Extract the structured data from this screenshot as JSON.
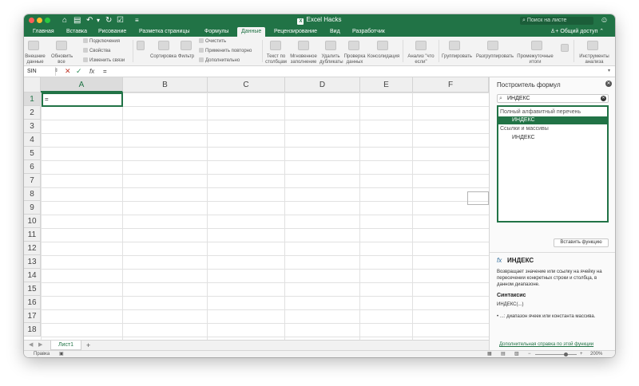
{
  "titlebar": {
    "doc_title": "Excel Hacks",
    "search_placeholder": "Поиск на листе",
    "share": "Общий доступ"
  },
  "tabs": [
    {
      "label": "Главная"
    },
    {
      "label": "Вставка"
    },
    {
      "label": "Рисование"
    },
    {
      "label": "Разметка страницы"
    },
    {
      "label": "Формулы"
    },
    {
      "label": "Данные",
      "active": true
    },
    {
      "label": "Рецензирование"
    },
    {
      "label": "Вид"
    },
    {
      "label": "Разработчик"
    }
  ],
  "ribbon": {
    "get_data": "Внешние данные",
    "refresh_all": "Обновить все",
    "connections": "Подключения",
    "properties": "Свойства",
    "edit_links": "Изменить связи",
    "sort": "Сортировка",
    "filter": "Фильтр",
    "clear": "Очистить",
    "reapply": "Применить повторно",
    "advanced": "Дополнительно",
    "text_to_columns": "Текст по столбцам",
    "flash_fill": "Мгновенное заполнение",
    "remove_duplicates": "Удалить дубликаты",
    "data_validation": "Проверка данных",
    "consolidate": "Консолидация",
    "what_if": "Анализ \"что если\"",
    "group": "Группировать",
    "ungroup": "Разгруппировать",
    "subtotal": "Промежуточные итоги",
    "analysis_tools": "Инструменты анализа"
  },
  "formula_bar": {
    "name_box": "SIN",
    "value": "="
  },
  "grid": {
    "columns": [
      "A",
      "B",
      "C",
      "D",
      "E",
      "F"
    ],
    "rows": [
      "1",
      "2",
      "3",
      "4",
      "5",
      "6",
      "7",
      "8",
      "9",
      "10",
      "11",
      "12",
      "13",
      "14",
      "15",
      "16",
      "17",
      "18"
    ],
    "active_cell_value": "="
  },
  "sheet_tabs": {
    "sheet1": "Лист1",
    "add": "+"
  },
  "status": {
    "mode": "Правка",
    "zoom": "200%"
  },
  "formula_builder": {
    "title": "Построитель формул",
    "search_value": "ИНДЕКС",
    "list": [
      {
        "label": "Полный алфавитный перечень",
        "kind": "cat"
      },
      {
        "label": "ИНДЕКС",
        "kind": "fn",
        "selected": true
      },
      {
        "label": "Ссылки и массивы",
        "kind": "cat"
      },
      {
        "label": "ИНДЕКС",
        "kind": "fn"
      }
    ],
    "insert_button": "Вставить функцию",
    "fx_label": "fx",
    "function_name": "ИНДЕКС",
    "description": "Возвращает значение или ссылку на ячейку на пересечении конкретных строки и столбца, в данном диапазоне.",
    "syntax_heading": "Синтаксис",
    "syntax": "ИНДЕКС(...)",
    "bullet": "...: диапазон ячеек или константа массива.",
    "help_link": "Дополнительная справка по этой функции"
  },
  "colors": {
    "accent": "#217346",
    "cancel": "#c0392b",
    "confirm": "#2e8b57"
  }
}
